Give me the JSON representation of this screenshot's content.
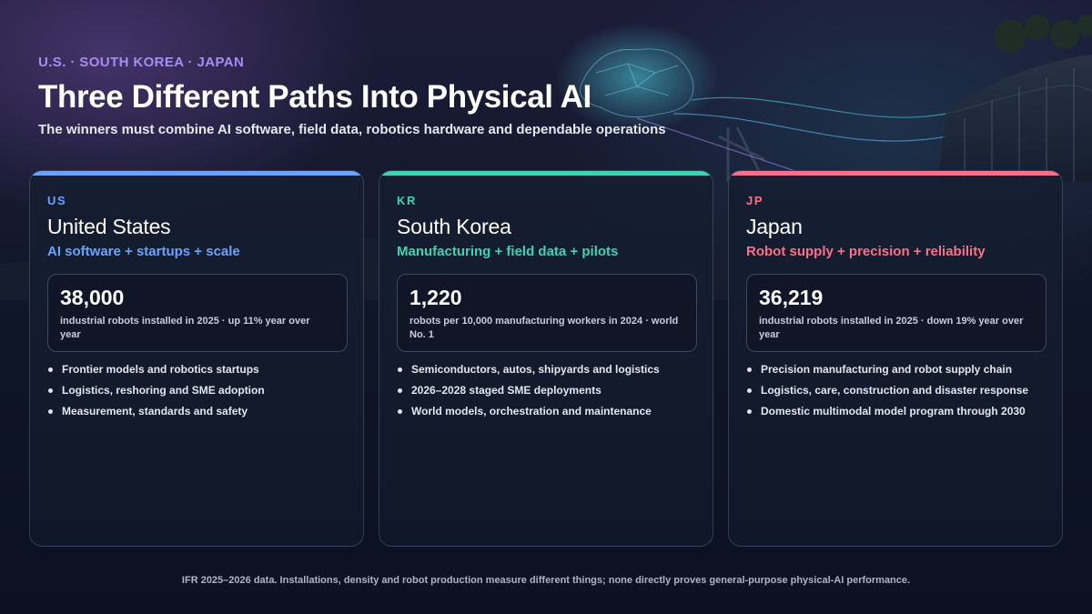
{
  "header": {
    "eyebrow": "U.S. · SOUTH KOREA · JAPAN",
    "title": "Three Different Paths Into Physical AI",
    "subtitle": "The winners must combine AI software, field data, robotics hardware and dependable operations"
  },
  "colors": {
    "eyebrow": "#a98cf3",
    "us_accent": "#6aa3ff",
    "kr_accent": "#3ed3b2",
    "jp_accent": "#ff6f86"
  },
  "cards": [
    {
      "code": "US",
      "name": "United States",
      "tagline": "AI software + startups + scale",
      "stat_value": "38,000",
      "stat_desc": "industrial robots installed in 2025 · up 11% year over year",
      "bullets": [
        "Frontier models and robotics startups",
        "Logistics, reshoring and SME adoption",
        "Measurement, standards and safety"
      ]
    },
    {
      "code": "KR",
      "name": "South Korea",
      "tagline": "Manufacturing + field data + pilots",
      "stat_value": "1,220",
      "stat_desc": "robots per 10,000 manufacturing workers in 2024 · world No. 1",
      "bullets": [
        "Semiconductors, autos, shipyards and logistics",
        "2026–2028 staged SME deployments",
        "World models, orchestration and maintenance"
      ]
    },
    {
      "code": "JP",
      "name": "Japan",
      "tagline": "Robot supply + precision + reliability",
      "stat_value": "36,219",
      "stat_desc": "industrial robots installed in 2025 · down 19% year over year",
      "bullets": [
        "Precision manufacturing and robot supply chain",
        "Logistics, care, construction and disaster response",
        "Domestic multimodal model program through 2030"
      ]
    }
  ],
  "footnote": "IFR 2025–2026 data. Installations, density and robot production measure different things; none directly proves general-purpose physical-AI performance."
}
